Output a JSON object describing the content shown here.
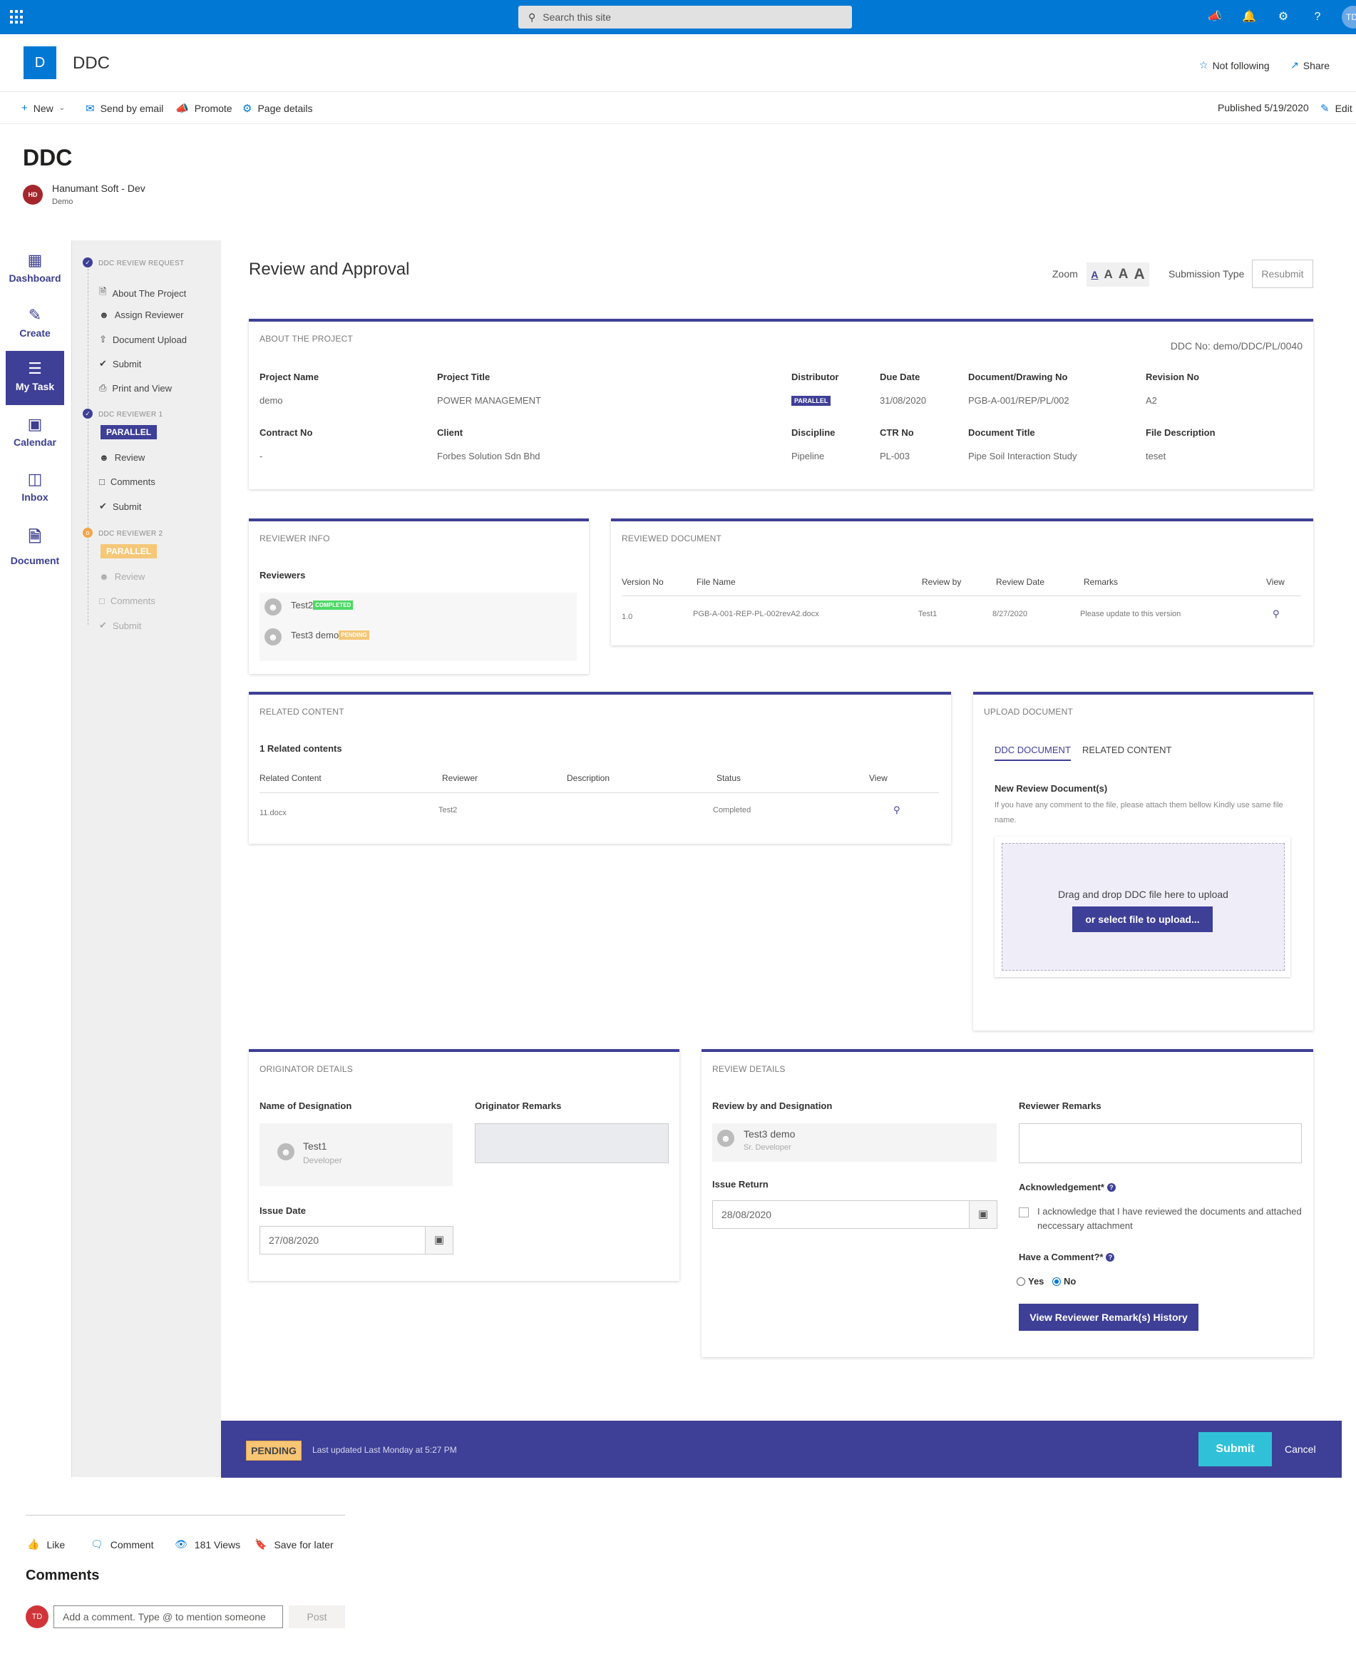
{
  "topbar": {
    "search_placeholder": "Search this site",
    "user_initials": "TD"
  },
  "site": {
    "logo_letter": "D",
    "name": "DDC",
    "follow": "Not following",
    "share": "Share"
  },
  "commands": {
    "new": "New",
    "send_email": "Send by email",
    "promote": "Promote",
    "page_details": "Page details",
    "published": "Published 5/19/2020",
    "edit": "Edit"
  },
  "page": {
    "title": "DDC",
    "author_initials": "HD",
    "author_name": "Hanumant Soft - Dev",
    "author_sub": "Demo"
  },
  "leftnav": [
    {
      "label": "Dashboard",
      "icon": "dashboard-icon"
    },
    {
      "label": "Create",
      "icon": "edit-icon"
    },
    {
      "label": "My Task",
      "icon": "task-list-icon"
    },
    {
      "label": "Calendar",
      "icon": "calendar-icon"
    },
    {
      "label": "Inbox",
      "icon": "inbox-icon"
    },
    {
      "label": "Document",
      "icon": "document-icon"
    }
  ],
  "sidebar": {
    "step1": {
      "title": "DDC REVIEW REQUEST",
      "items": [
        "About The Project",
        "Assign Reviewer",
        "Document Upload",
        "Submit",
        "Print and View"
      ]
    },
    "step2": {
      "title": "DDC REVIEWER 1",
      "badge": "PARALLEL",
      "items": [
        "Review",
        "Comments",
        "Submit"
      ]
    },
    "step3": {
      "title": "DDC REVIEWER 2",
      "badge": "PARALLEL",
      "items": [
        "Review",
        "Comments",
        "Submit"
      ]
    }
  },
  "main": {
    "title": "Review and Approval",
    "zoom_label": "Zoom",
    "zoom_letters": [
      "A",
      "A",
      "A",
      "A"
    ],
    "submission_type_label": "Submission Type",
    "submission_type_value": "Resubmit"
  },
  "about": {
    "title": "ABOUT THE PROJECT",
    "ddc_no": "DDC No: demo/DDC/PL/0040",
    "project_name_label": "Project Name",
    "project_name": "demo",
    "project_title_label": "Project Title",
    "project_title": "POWER MANAGEMENT",
    "distributor_label": "Distributor",
    "distributor": "PARALLEL",
    "due_date_label": "Due Date",
    "due_date": "31/08/2020",
    "doc_no_label": "Document/Drawing No",
    "doc_no": "PGB-A-001/REP/PL/002",
    "revision_label": "Revision No",
    "revision": "A2",
    "contract_label": "Contract No",
    "contract": "-",
    "client_label": "Client",
    "client": "Forbes Solution Sdn Bhd",
    "discipline_label": "Discipline",
    "discipline": "Pipeline",
    "ctr_label": "CTR No",
    "ctr": "PL-003",
    "doc_title_label": "Document Title",
    "doc_title": "Pipe Soil Interaction Study",
    "file_desc_label": "File Description",
    "file_desc": "teset"
  },
  "reviewer_info": {
    "title": "REVIEWER INFO",
    "reviewers_label": "Reviewers",
    "reviewers": [
      {
        "name": "Test2",
        "status": "COMPLETED"
      },
      {
        "name": "Test3 demo",
        "status": "PENDING"
      }
    ]
  },
  "reviewed_doc": {
    "title": "REVIEWED DOCUMENT",
    "headers": [
      "Version No",
      "File Name",
      "Review by",
      "Review Date",
      "Remarks",
      "View"
    ],
    "row": [
      "1.0",
      "PGB-A-001-REP-PL-002revA2.docx",
      "Test1",
      "8/27/2020",
      "Please update to this version"
    ]
  },
  "related": {
    "title": "RELATED CONTENT",
    "count": "1 Related contents",
    "headers": [
      "Related Content",
      "Reviewer",
      "Description",
      "Status",
      "View"
    ],
    "row": [
      "11.docx",
      "Test2",
      "",
      "Completed"
    ]
  },
  "upload": {
    "title": "UPLOAD DOCUMENT",
    "tabs": [
      "DDC DOCUMENT",
      "RELATED CONTENT"
    ],
    "new_label": "New Review Document(s)",
    "hint": "If you have any comment to the file, please attach them bellow Kindly use same file name.",
    "drop_text": "Drag and drop DDC file here to upload",
    "select_btn": "or select file to upload..."
  },
  "originator": {
    "title": "ORIGINATOR DETAILS",
    "designation_label": "Name of Designation",
    "name": "Test1",
    "role": "Developer",
    "remarks_label": "Originator Remarks",
    "issue_date_label": "Issue Date",
    "issue_date": "27/08/2020"
  },
  "review_details": {
    "title": "REVIEW DETAILS",
    "designation_label": "Review by and Designation",
    "name": "Test3 demo",
    "role": "Sr. Developer",
    "remarks_label": "Reviewer Remarks",
    "issue_return_label": "Issue Return",
    "issue_return": "28/08/2020",
    "ack_label": "Acknowledgement*",
    "ack_text": "I acknowledge that I have reviewed the documents and attached neccessary attachment",
    "comment_label": "Have a Comment?*",
    "yes": "Yes",
    "no": "No",
    "history_btn": "View Reviewer Remark(s) History"
  },
  "footer": {
    "status": "PENDING",
    "updated": "Last updated Last Monday at 5:27 PM",
    "submit": "Submit",
    "cancel": "Cancel"
  },
  "social": {
    "like": "Like",
    "comment": "Comment",
    "views": "181 Views",
    "save": "Save for later"
  },
  "comments": {
    "title": "Comments",
    "avatar": "TD",
    "placeholder": "Add a comment. Type @ to mention someone",
    "post": "Post"
  }
}
